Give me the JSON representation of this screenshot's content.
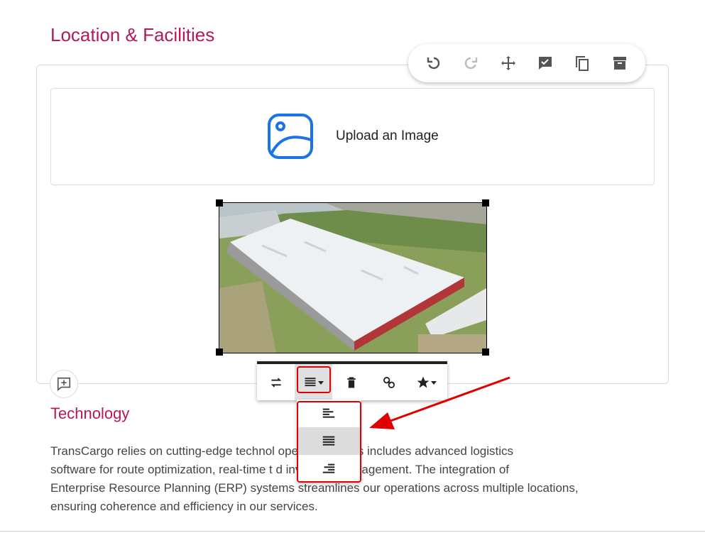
{
  "section": {
    "title": "Location & Facilities"
  },
  "top_toolbar": {
    "icons": [
      "undo-icon",
      "redo-icon",
      "move-icon",
      "check-comment-icon",
      "duplicate-icon",
      "archive-icon"
    ]
  },
  "upload": {
    "label": "Upload an Image"
  },
  "image_toolbar": {
    "icons": [
      "swap-icon",
      "align-icon",
      "delete-icon",
      "link-icon",
      "star-icon"
    ]
  },
  "align_dropdown": {
    "options": [
      "align-left-icon",
      "align-center-icon",
      "align-right-icon"
    ],
    "selected_index": 1
  },
  "technology": {
    "title": "Technology",
    "lines": [
      "TransCargo relies on cutting-edge technol operations. This includes advanced logistics",
      "software for route optimization, real-time t d inventory management. The integration of",
      "Enterprise Resource Planning (ERP) systems streamlines our operations across multiple locations,",
      "ensuring coherence and efficiency in our services."
    ]
  },
  "colors": {
    "accent": "#b3195b",
    "annotation": "#e00000",
    "upload_icon": "#1a73e8"
  }
}
